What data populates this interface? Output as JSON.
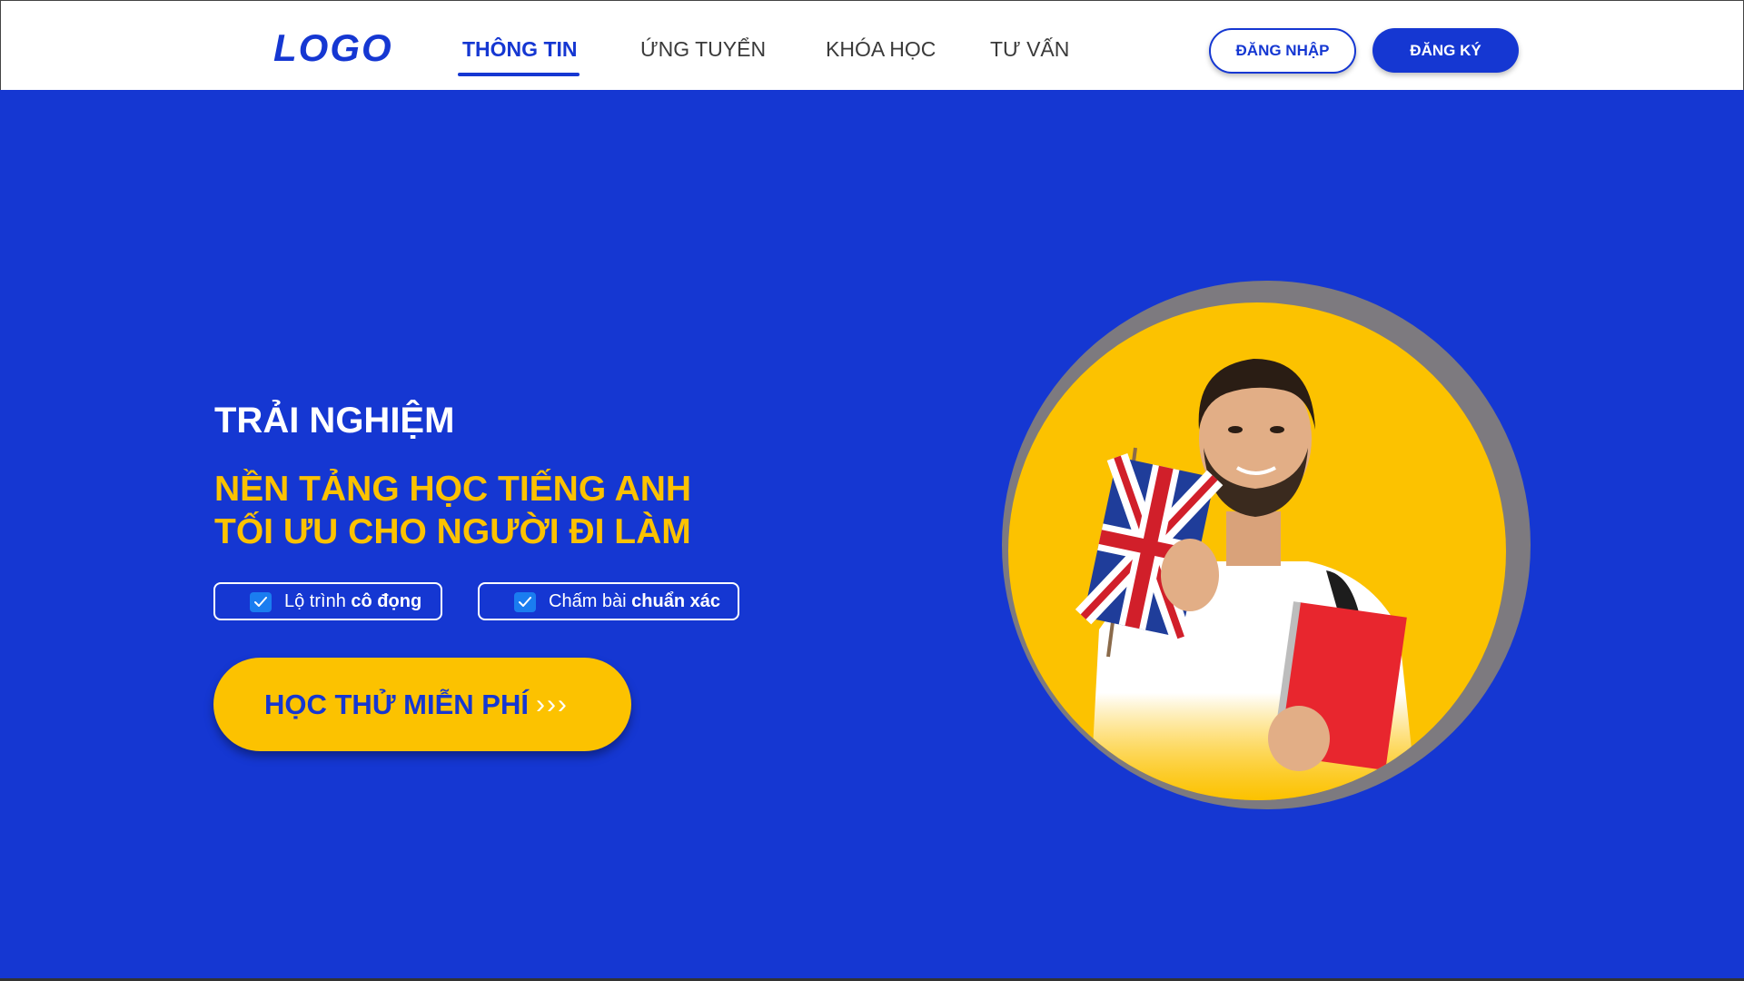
{
  "header": {
    "logo": "LOGO",
    "nav": [
      {
        "label": "THÔNG TIN",
        "active": true
      },
      {
        "label": "ỨNG TUYỂN",
        "active": false
      },
      {
        "label": "KHÓA HỌC",
        "active": false
      },
      {
        "label": "TƯ VẤN",
        "active": false
      }
    ],
    "login_label": "ĐĂNG NHẬP",
    "register_label": "ĐĂNG KÝ"
  },
  "hero": {
    "subtitle": "TRẢI NGHIỆM",
    "title_line1": "NỀN TẢNG HỌC TIẾNG ANH",
    "title_line2": "TỐI ƯU CHO NGƯỜI ĐI LÀM",
    "features": [
      {
        "prefix": "Lộ trình",
        "bold": "cô đọng"
      },
      {
        "prefix": "Chấm bài",
        "bold": "chuẩn xác"
      }
    ],
    "cta_label": "HỌC THỬ MIỄN PHÍ",
    "cta_arrows": "›››"
  },
  "colors": {
    "primary": "#1537d2",
    "accent": "#fcc200",
    "white": "#ffffff",
    "ring": "#7d7a7f",
    "check": "#1a7df0"
  },
  "icons": {
    "feature_check": "check-icon",
    "illustration": "teacher-with-uk-flag-illustration"
  }
}
